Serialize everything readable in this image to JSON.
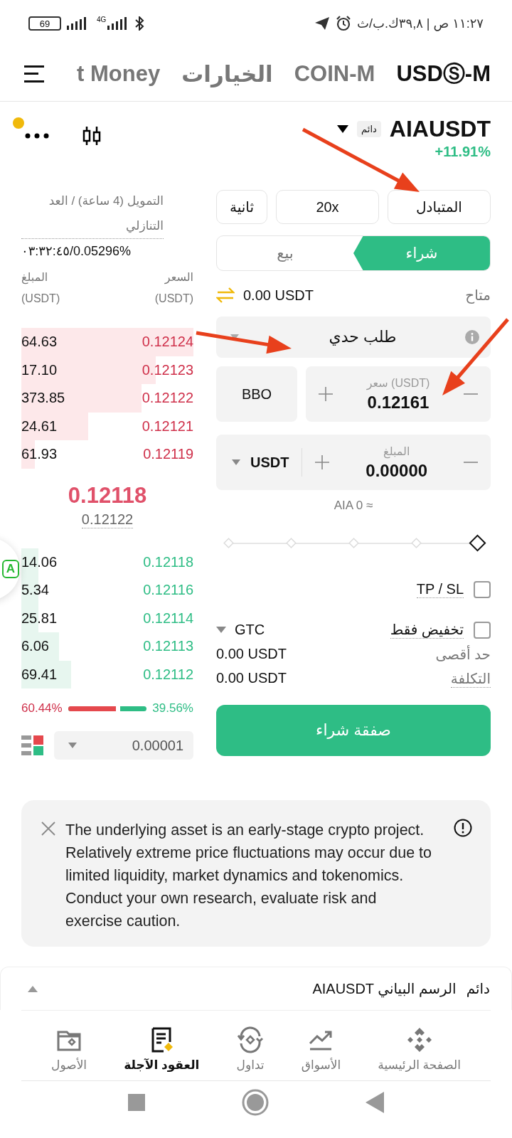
{
  "status_bar": {
    "battery": "69",
    "network": "4G",
    "time": "١١:٢٧ ص | ٣٩,٨ك.ب/ث"
  },
  "tabs": [
    {
      "label": "USDⓈ-M",
      "selected": true
    },
    {
      "label": "COIN-M",
      "selected": false
    },
    {
      "label": "الخيارات",
      "selected": false
    },
    {
      "label": "t Money",
      "selected": false
    }
  ],
  "symbol": {
    "name": "AIAUSDT",
    "badge": "دائم",
    "change": "+11.91%",
    "notification_dot": true
  },
  "order_book": {
    "funding_label": "التمويل (4 ساعة) / العد التنازلي",
    "funding_value": "٠٣:٣٢:٤٥/0.05296%",
    "price_heading": "السعر",
    "amount_heading": "المبلغ",
    "price_unit": "(USDT)",
    "amount_unit": "(USDT)",
    "asks": [
      {
        "price": "0.12124",
        "amount": "64.63"
      },
      {
        "price": "0.12123",
        "amount": "17.10"
      },
      {
        "price": "0.12122",
        "amount": "373.85"
      },
      {
        "price": "0.12121",
        "amount": "24.61"
      },
      {
        "price": "0.12119",
        "amount": "61.93"
      }
    ],
    "last_price": "0.12118",
    "mark_price": "0.12122",
    "bids": [
      {
        "price": "0.12118",
        "amount": "14.06"
      },
      {
        "price": "0.12116",
        "amount": "5.34"
      },
      {
        "price": "0.12114",
        "amount": "25.81"
      },
      {
        "price": "0.12113",
        "amount": "6.06"
      },
      {
        "price": "0.12112",
        "amount": "69.41"
      }
    ],
    "sell_ratio": "60.44%",
    "buy_ratio": "39.56%",
    "ratio": {
      "level": 0.6044
    },
    "precision": "0.00001"
  },
  "order_form": {
    "settings": [
      "المتبادل",
      "20x",
      "ثانية"
    ],
    "sides": [
      {
        "label": "شراء",
        "selected": true
      },
      {
        "label": "بيع",
        "selected": false
      }
    ],
    "available_label": "متاح",
    "available_value": "0.00 USDT",
    "order_type": "طلب حدي",
    "price": {
      "label": "سعر (USDT)",
      "value": "0.12161",
      "bbo": "BBO"
    },
    "amount": {
      "label": "المبلغ",
      "value": "0.00000",
      "unit": "USDT"
    },
    "estimate": "AIA 0 ≈",
    "options": [
      {
        "label": "TP / SL",
        "checked": false
      },
      {
        "label": "تخفيض فقط",
        "checked": false
      }
    ],
    "time_in_force": "GTC",
    "max_label": "حد أقصى",
    "max_value": "0.00 USDT",
    "cost_label": "التكلفة",
    "cost_value": "0.00 USDT",
    "submit": "صفقة شراء"
  },
  "warning": {
    "text": "The underlying asset is an early-stage crypto project. Relatively extreme price fluctuations may occur due to limited liquidity, market dynamics and tokenomics. Conduct your own research, evaluate risk and exercise caution."
  },
  "chart_bar": {
    "badge": "دائم",
    "title": "AIAUSDT الرسم البياني"
  },
  "floating_button": {
    "label": "A"
  },
  "bottom_nav": [
    {
      "label": "الصفحة الرئيسية",
      "selected": false
    },
    {
      "label": "الأسواق",
      "selected": false
    },
    {
      "label": "تداول",
      "selected": false
    },
    {
      "label": "العقود الآجلة",
      "selected": true
    },
    {
      "label": "الأصول",
      "selected": false
    }
  ],
  "annotation_arrows": [
    {
      "kind": "arrow"
    },
    {
      "kind": "arrow"
    },
    {
      "kind": "arrow"
    }
  ]
}
